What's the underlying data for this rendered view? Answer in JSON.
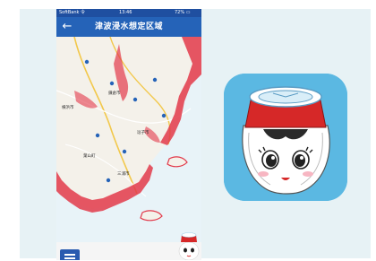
{
  "phone": {
    "status": {
      "carrier": "SoftBank 令",
      "time": "13:46",
      "battery": "72% ▭"
    },
    "header": {
      "title": "津波浸水想定区域",
      "back_icon": "back-arrow-icon"
    },
    "map": {
      "place_labels": [
        "横浜市",
        "鎌倉市",
        "逗子市",
        "葉山町",
        "三浦市"
      ]
    },
    "bottom_bar": {
      "menu_icon": "hamburger-menu-icon",
      "mascot": "mascot-character-icon"
    }
  },
  "app_icon": {
    "name": "mascot-app-icon"
  },
  "colors": {
    "header": "#2563b8",
    "status_bar": "#1f4fa0",
    "flood_zone": "#e2394a",
    "icon_background": "#5bb8e2",
    "hat_red": "#d62828"
  }
}
